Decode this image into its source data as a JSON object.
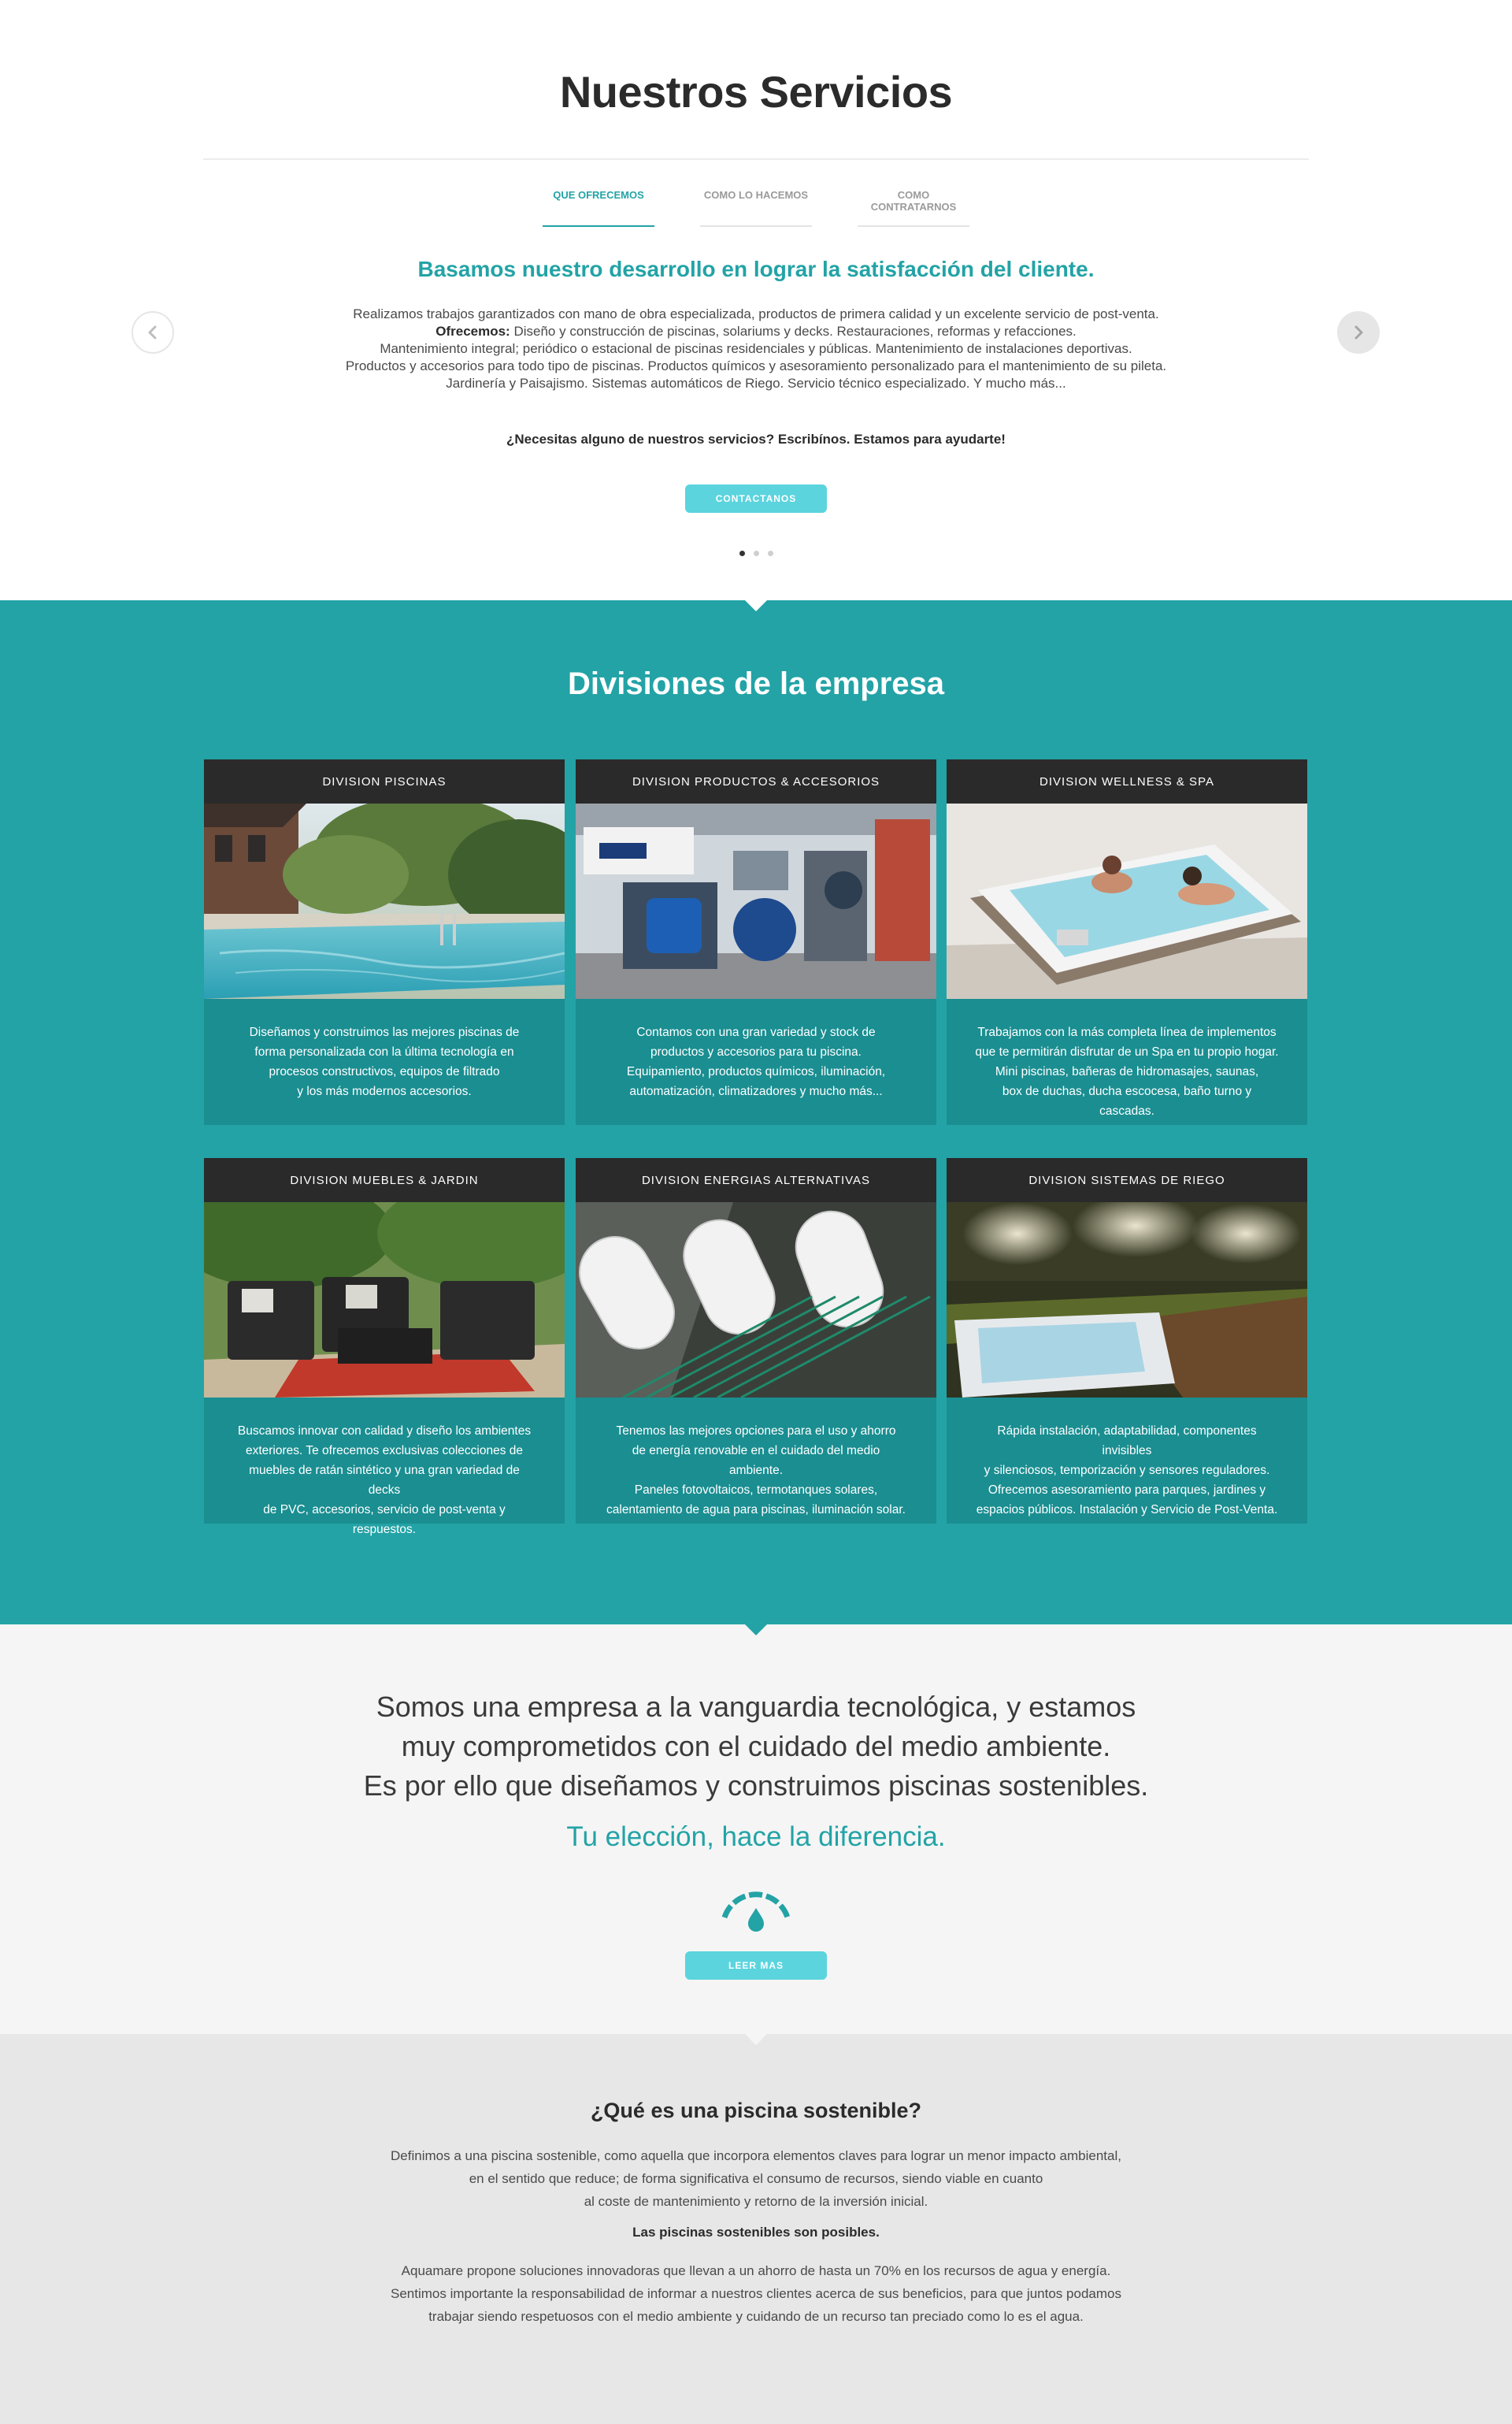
{
  "servicios": {
    "title": "Nuestros Servicios",
    "tabs": [
      {
        "label": "QUE OFRECEMOS"
      },
      {
        "label": "COMO LO HACEMOS"
      },
      {
        "label": "COMO CONTRATARNOS"
      }
    ],
    "headline": "Basamos nuestro desarrollo en lograr la satisfacción del cliente.",
    "lines": [
      "Realizamos trabajos garantizados con mano de obra especializada, productos de primera calidad y un excelente servicio de post-venta.",
      "Diseño y construcción de piscinas, solariums y decks. Restauraciones, reformas y refacciones.",
      "Mantenimiento integral; periódico o estacional de piscinas residenciales y públicas. Mantenimiento de instalaciones deportivas.",
      "Productos y accesorios para todo tipo de piscinas. Productos químicos y asesoramiento personalizado para el mantenimiento de su pileta.",
      "Jardinería y Paisajismo. Sistemas automáticos de Riego. Servicio técnico especializado. Y mucho más..."
    ],
    "ofrecemos_label": "Ofrecemos:",
    "cta_text": "¿Necesitas alguno de nuestros servicios? Escribínos. Estamos para ayudarte!",
    "button": "CONTACTANOS"
  },
  "divisiones": {
    "title": "Divisiones de la empresa",
    "cards": [
      {
        "title": "DIVISION PISCINAS",
        "lines": [
          "Diseñamos y construimos las mejores piscinas de",
          "forma personalizada con la última tecnología en",
          "procesos constructivos, equipos de filtrado",
          "y los más modernos accesorios."
        ]
      },
      {
        "title": "DIVISION PRODUCTOS & ACCESORIOS",
        "lines": [
          "Contamos con una gran variedad y stock de",
          "productos y accesorios para tu piscina.",
          "Equipamiento, productos químicos, iluminación,",
          "automatización, climatizadores y mucho más..."
        ]
      },
      {
        "title": "DIVISION WELLNESS & SPA",
        "lines": [
          "Trabajamos con la más completa línea de implementos",
          "que te permitirán disfrutar de un Spa en tu propio hogar.",
          "Mini piscinas, bañeras de hidromasajes, saunas,",
          "box de duchas, ducha escocesa, baño turno y cascadas."
        ]
      },
      {
        "title": "DIVISION MUEBLES & JARDIN",
        "lines": [
          "Buscamos innovar con calidad y diseño los ambientes",
          "exteriores. Te ofrecemos exclusivas colecciones de",
          "muebles de ratán sintético y una gran variedad de decks",
          "de PVC, accesorios, servicio de post-venta y respuestos."
        ]
      },
      {
        "title": "DIVISION ENERGIAS ALTERNATIVAS",
        "lines": [
          "Tenemos las mejores opciones para el uso y ahorro",
          "de energía renovable en el cuidado del medio ambiente.",
          "Paneles fotovoltaicos, termotanques solares,",
          "calentamiento de agua para piscinas, iluminación solar."
        ]
      },
      {
        "title": "DIVISION SISTEMAS DE RIEGO",
        "lines": [
          "Rápida instalación, adaptabilidad, componentes invisibles",
          "y silenciosos, temporización y sensores reguladores.",
          "Ofrecemos asesoramiento para parques, jardines y",
          "espacios públicos. Instalación y Servicio de Post-Venta."
        ]
      }
    ]
  },
  "vanguardia": {
    "lines": [
      "Somos una empresa a la vanguardia tecnológica, y estamos",
      "muy comprometidos con el cuidado del medio ambiente.",
      "Es por ello que diseñamos y construimos piscinas sostenibles."
    ],
    "slogan": "Tu elección, hace la diferencia.",
    "button": "LEER MAS"
  },
  "sostenible": {
    "title": "¿Qué es una piscina sostenible?",
    "p1": [
      "Definimos a una piscina sostenible, como aquella que incorpora elementos claves para lograr un menor impacto ambiental,",
      "en el sentido que reduce; de forma significativa el consumo de recursos, siendo viable en cuanto",
      "al coste de mantenimiento y retorno de la inversión inicial."
    ],
    "strong": "Las piscinas sostenibles son posibles.",
    "p2": [
      "Aquamare propone soluciones innovadoras que llevan a un ahorro de hasta un 70% en los recursos de agua y energía.",
      "Sentimos importante la responsabilidad de informar a nuestros clientes acerca de sus beneficios, para que juntos podamos",
      "trabajar siendo respetuosos con el medio ambiente y cuidando de un recurso tan preciado como lo es el agua."
    ]
  },
  "colors": {
    "teal": "#23a3a6",
    "teal_dark": "#1a8e91",
    "button": "#5bd4de",
    "card_header": "#2a2a2a"
  },
  "icons": [
    "chevron-left-icon",
    "chevron-right-icon",
    "gauge-drop-icon"
  ]
}
